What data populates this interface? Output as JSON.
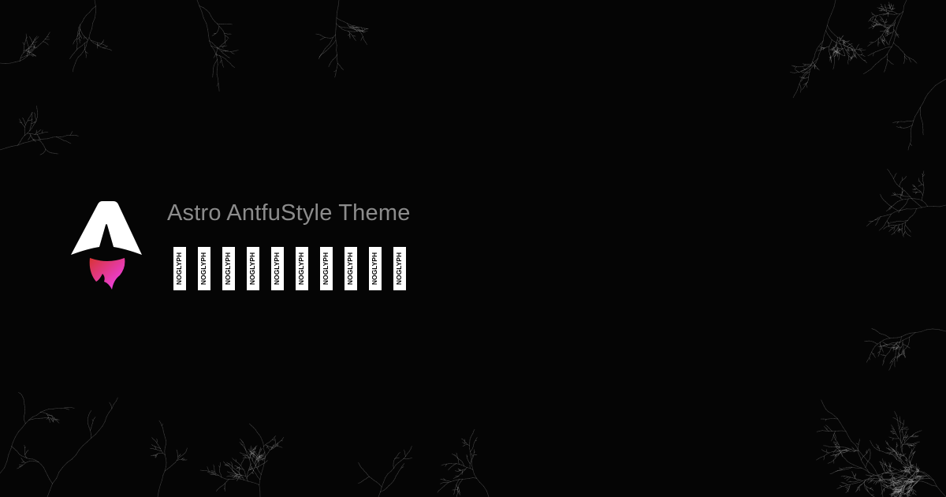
{
  "title": "Astro AntfuStyle Theme",
  "subtitle_glyphs": [
    "NOGLYPH",
    "NOGLYPH",
    "NOGLYPH",
    "NOGLYPH",
    "NOGLYPH",
    "NOGLYPH",
    "NOGLYPH",
    "NOGLYPH",
    "NOGLYPH",
    "NOGLYPH"
  ],
  "colors": {
    "background": "#050505",
    "title": "#8c8c8c",
    "logo_white": "#ffffff",
    "logo_gradient_start": "#d83333",
    "logo_gradient_end": "#f041ff",
    "branches": "#ffffff"
  },
  "icons": {
    "logo": "astro-logo-icon"
  }
}
